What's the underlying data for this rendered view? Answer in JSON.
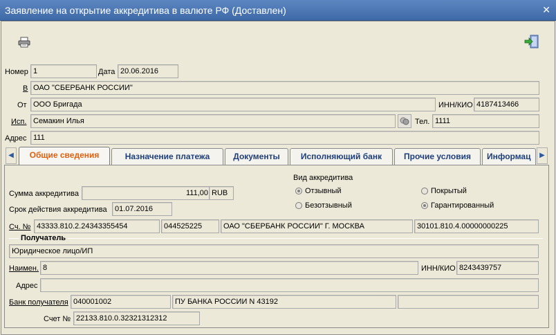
{
  "window": {
    "title": "Заявление на открытие аккредитива в валюте РФ (Доставлен)",
    "close_glyph": "✕"
  },
  "toolbar": {
    "print_icon": "printer-icon",
    "exit_icon": "exit-door-icon"
  },
  "header": {
    "number_label": "Номер",
    "number_value": "1",
    "date_label": "Дата",
    "date_value": "20.06.2016",
    "to_label": "В",
    "to_value": "ОАО \"СБЕРБАНК РОССИИ\"",
    "from_label": "От",
    "from_value": "ООО Бригада",
    "inn_label": "ИНН/КИО",
    "inn_value": "4187413466",
    "executor_label": "Исп.",
    "executor_value": "Семакин Илья",
    "phone_label": "Тел.",
    "phone_value": "1111",
    "address_label": "Адрес",
    "address_value": "111"
  },
  "tabs": [
    {
      "label": "Общие сведения",
      "active": true
    },
    {
      "label": "Назначение платежа",
      "active": false
    },
    {
      "label": "Документы",
      "active": false
    },
    {
      "label": "Исполняющий банк",
      "active": false
    },
    {
      "label": "Прочие условия",
      "active": false
    },
    {
      "label": "Информац",
      "active": false
    }
  ],
  "general": {
    "amount_label": "Сумма аккредитива",
    "amount_value": "111,00",
    "currency_value": "RUB",
    "validity_label": "Срок действия аккредитива",
    "validity_value": "01.07.2016",
    "type_title": "Вид аккредитива",
    "type_options": [
      {
        "label": "Отзывный",
        "selected": true
      },
      {
        "label": "Безотзывный",
        "selected": false
      },
      {
        "label": "Покрытый",
        "selected": false
      },
      {
        "label": "Гарантированный",
        "selected": true
      }
    ],
    "account_label": "Сч. №",
    "account_value": "43333.810.2.24343355454",
    "bik_value": "044525225",
    "bank_value": "ОАО \"СБЕРБАНК РОССИИ\" Г. МОСКВА",
    "corr_value": "30101.810.4.00000000225"
  },
  "recipient": {
    "section_title": "Получатель",
    "kind_value": "Юридическое лицо/ИП",
    "name_label": "Наимен.",
    "name_value": "8",
    "inn_label": "ИНН/КИО",
    "inn_value": "8243439757",
    "address_label": "Адрес",
    "address_value": "",
    "bank_label": "Банк получателя",
    "bank_bik_value": "040001002",
    "bank_name_value": "ПУ БАНКА РОССИИ N 43192",
    "bank_extra_value": "",
    "account_label": "Счет №",
    "account_value": "22133.810.0.32321312312"
  }
}
